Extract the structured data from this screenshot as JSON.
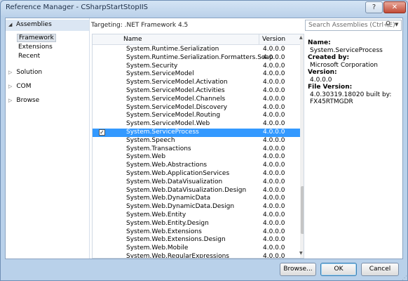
{
  "window": {
    "title": "Reference Manager - CSharpStartStopIIS",
    "help_label": "?",
    "close_label": "✕"
  },
  "nav": {
    "header": "Assemblies",
    "subitems": [
      {
        "label": "Framework",
        "selected": true
      },
      {
        "label": "Extensions",
        "selected": false
      },
      {
        "label": "Recent",
        "selected": false
      }
    ],
    "groups": [
      {
        "label": "Solution"
      },
      {
        "label": "COM"
      },
      {
        "label": "Browse"
      }
    ]
  },
  "targeting": "Targeting: .NET Framework 4.5",
  "search": {
    "placeholder": "Search Assemblies (Ctrl+E)",
    "icon": "search-icon"
  },
  "list": {
    "columns": {
      "name": "Name",
      "version": "Version"
    },
    "rows": [
      {
        "name": "System.Runtime.Serialization",
        "version": "4.0.0.0",
        "checked": false,
        "selected": false
      },
      {
        "name": "System.Runtime.Serialization.Formatters.Soap",
        "version": "4.0.0.0",
        "checked": false,
        "selected": false
      },
      {
        "name": "System.Security",
        "version": "4.0.0.0",
        "checked": false,
        "selected": false
      },
      {
        "name": "System.ServiceModel",
        "version": "4.0.0.0",
        "checked": false,
        "selected": false
      },
      {
        "name": "System.ServiceModel.Activation",
        "version": "4.0.0.0",
        "checked": false,
        "selected": false
      },
      {
        "name": "System.ServiceModel.Activities",
        "version": "4.0.0.0",
        "checked": false,
        "selected": false
      },
      {
        "name": "System.ServiceModel.Channels",
        "version": "4.0.0.0",
        "checked": false,
        "selected": false
      },
      {
        "name": "System.ServiceModel.Discovery",
        "version": "4.0.0.0",
        "checked": false,
        "selected": false
      },
      {
        "name": "System.ServiceModel.Routing",
        "version": "4.0.0.0",
        "checked": false,
        "selected": false
      },
      {
        "name": "System.ServiceModel.Web",
        "version": "4.0.0.0",
        "checked": false,
        "selected": false
      },
      {
        "name": "System.ServiceProcess",
        "version": "4.0.0.0",
        "checked": true,
        "selected": true
      },
      {
        "name": "System.Speech",
        "version": "4.0.0.0",
        "checked": false,
        "selected": false
      },
      {
        "name": "System.Transactions",
        "version": "4.0.0.0",
        "checked": false,
        "selected": false
      },
      {
        "name": "System.Web",
        "version": "4.0.0.0",
        "checked": false,
        "selected": false
      },
      {
        "name": "System.Web.Abstractions",
        "version": "4.0.0.0",
        "checked": false,
        "selected": false
      },
      {
        "name": "System.Web.ApplicationServices",
        "version": "4.0.0.0",
        "checked": false,
        "selected": false
      },
      {
        "name": "System.Web.DataVisualization",
        "version": "4.0.0.0",
        "checked": false,
        "selected": false
      },
      {
        "name": "System.Web.DataVisualization.Design",
        "version": "4.0.0.0",
        "checked": false,
        "selected": false
      },
      {
        "name": "System.Web.DynamicData",
        "version": "4.0.0.0",
        "checked": false,
        "selected": false
      },
      {
        "name": "System.Web.DynamicData.Design",
        "version": "4.0.0.0",
        "checked": false,
        "selected": false
      },
      {
        "name": "System.Web.Entity",
        "version": "4.0.0.0",
        "checked": false,
        "selected": false
      },
      {
        "name": "System.Web.Entity.Design",
        "version": "4.0.0.0",
        "checked": false,
        "selected": false
      },
      {
        "name": "System.Web.Extensions",
        "version": "4.0.0.0",
        "checked": false,
        "selected": false
      },
      {
        "name": "System.Web.Extensions.Design",
        "version": "4.0.0.0",
        "checked": false,
        "selected": false
      },
      {
        "name": "System.Web.Mobile",
        "version": "4.0.0.0",
        "checked": false,
        "selected": false
      },
      {
        "name": "System.Web.RegularExpressions",
        "version": "4.0.0.0",
        "checked": false,
        "selected": false
      }
    ]
  },
  "details": {
    "name_label": "Name:",
    "name_value": "System.ServiceProcess",
    "created_label": "Created by:",
    "created_value": "Microsoft Corporation",
    "version_label": "Version:",
    "version_value": "4.0.0.0",
    "file_version_label": "File Version:",
    "file_version_value": "4.0.30319.18020 built by: FX45RTMGDR"
  },
  "buttons": {
    "browse": "Browse...",
    "ok": "OK",
    "cancel": "Cancel"
  },
  "colors": {
    "selection": "#3399ff",
    "window_frame": "#b9d1ea"
  }
}
